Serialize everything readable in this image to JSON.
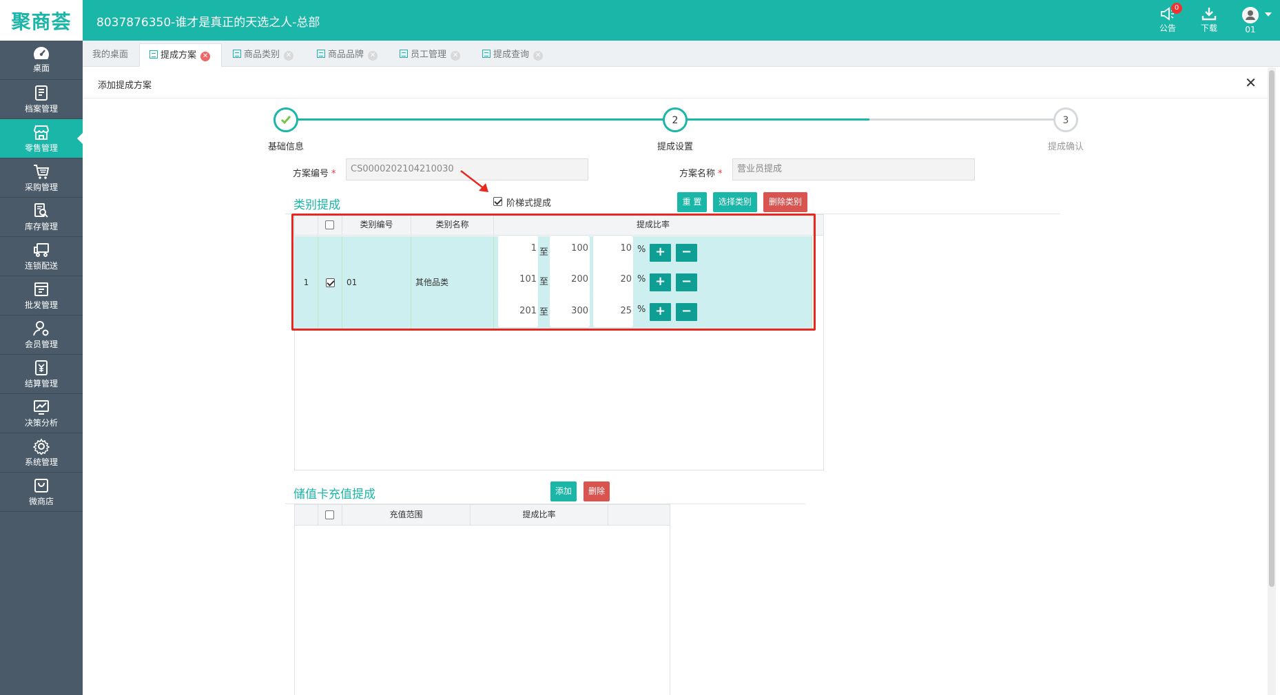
{
  "header": {
    "logo": "聚商荟",
    "title": "8037876350-谁才是真正的天选之人-总部",
    "notice_label": "公告",
    "notice_badge": "0",
    "download_label": "下载",
    "user_label": "01"
  },
  "sidebar": {
    "items": [
      {
        "label": "桌面",
        "icon": "dashboard-icon"
      },
      {
        "label": "档案管理",
        "icon": "archive-icon"
      },
      {
        "label": "零售管理",
        "icon": "store-icon"
      },
      {
        "label": "采购管理",
        "icon": "cart-icon"
      },
      {
        "label": "库存管理",
        "icon": "inventory-search-icon"
      },
      {
        "label": "连锁配送",
        "icon": "truck-icon"
      },
      {
        "label": "批发管理",
        "icon": "wholesale-icon"
      },
      {
        "label": "会员管理",
        "icon": "member-icon"
      },
      {
        "label": "结算管理",
        "icon": "settlement-icon"
      },
      {
        "label": "决策分析",
        "icon": "chart-icon"
      },
      {
        "label": "系统管理",
        "icon": "gear-icon"
      },
      {
        "label": "微商店",
        "icon": "bag-icon"
      }
    ],
    "active_index": 2
  },
  "tabs": [
    {
      "label": "我的桌面",
      "closable": false
    },
    {
      "label": "提成方案",
      "closable": true,
      "active": true
    },
    {
      "label": "商品类别",
      "closable": true
    },
    {
      "label": "商品品牌",
      "closable": true
    },
    {
      "label": "员工管理",
      "closable": true
    },
    {
      "label": "提成查询",
      "closable": true
    }
  ],
  "panel": {
    "title": "添加提成方案"
  },
  "steps": [
    {
      "label": "基础信息",
      "number": "",
      "state": "done"
    },
    {
      "label": "提成设置",
      "number": "2",
      "state": "current"
    },
    {
      "label": "提成确认",
      "number": "3",
      "state": "pending"
    }
  ],
  "form": {
    "scheme_no_label": "方案编号",
    "scheme_no_value": "CS0000202104210030",
    "scheme_name_label": "方案名称",
    "scheme_name_placeholder": "营业员提成",
    "required_mark": "*"
  },
  "category_section": {
    "title": "类别提成",
    "tiered_label": "阶梯式提成",
    "tiered_checked": true,
    "reset_button": "重 置",
    "select_button": "选择类别",
    "delete_button": "删除类别",
    "columns": [
      "类别编号",
      "类别名称",
      "提成比率"
    ],
    "rows": [
      {
        "index": "1",
        "checked": true,
        "code": "01",
        "name": "其他品类",
        "tiers": [
          {
            "from": "1",
            "to": "100",
            "rate": "10"
          },
          {
            "from": "101",
            "to": "200",
            "rate": "20"
          },
          {
            "from": "201",
            "to": "300",
            "rate": "25"
          }
        ]
      }
    ],
    "range_separator": "至",
    "percent_sign": "%",
    "add_symbol": "+",
    "remove_symbol": "−"
  },
  "card_section": {
    "title": "储值卡充值提成",
    "add_button": "添加",
    "delete_button": "删除",
    "columns": [
      "充值范围",
      "提成比率"
    ]
  },
  "colors": {
    "brand": "#1ab6a7",
    "sidebar": "#4a5a69",
    "danger": "#d9534f",
    "highlight": "#e8271e",
    "row_selected": "#cdeff0"
  }
}
